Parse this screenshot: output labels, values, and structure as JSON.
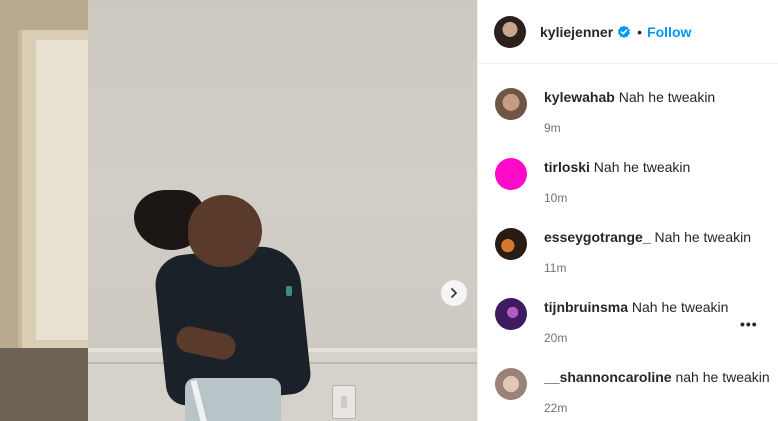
{
  "post": {
    "owner": "kyliejenner",
    "separator": "•",
    "follow_label": "Follow"
  },
  "colors": {
    "follow": "#0095f6",
    "verified": "#0095f6",
    "text": "#262626",
    "muted": "#737373"
  },
  "icons": {
    "next": "chevron-right-icon",
    "verified": "verified-badge-icon",
    "more": "more-options-icon"
  },
  "comments": [
    {
      "user": "kylewahab",
      "text": "Nah he tweakin",
      "time": "9m"
    },
    {
      "user": "tirloski",
      "text": "Nah he tweakin",
      "time": "10m"
    },
    {
      "user": "esseygotrange_",
      "text": "Nah he tweakin",
      "time": "11m"
    },
    {
      "user": "tijnbruinsma",
      "text": "Nah he tweakin",
      "time": "20m"
    },
    {
      "user": "__shannoncaroline",
      "text": "nah he tweakin",
      "time": "22m"
    }
  ],
  "more_label": "•••"
}
